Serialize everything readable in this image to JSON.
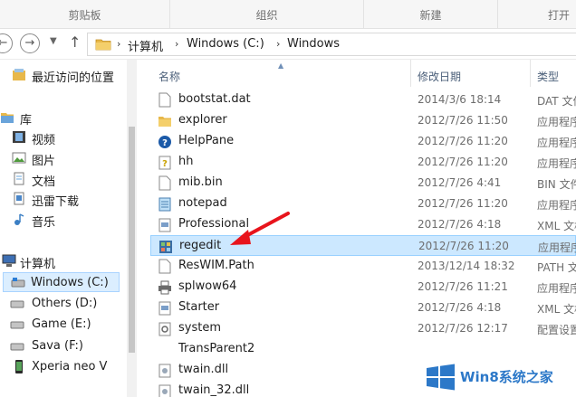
{
  "ribbon": {
    "groups": [
      "剪贴板",
      "组织",
      "新建",
      "打开"
    ]
  },
  "nav": {
    "back_icon": "back-arrow-icon",
    "forward_icon": "forward-arrow-icon",
    "breadcrumb": [
      "计算机",
      "Windows (C:)",
      "Windows"
    ]
  },
  "sidebar": {
    "items": [
      {
        "label": "最近访问的位置",
        "icon": "recent-places-icon"
      },
      {
        "label": "库",
        "icon": "library-icon"
      },
      {
        "label": "视频",
        "icon": "video-icon"
      },
      {
        "label": "图片",
        "icon": "pictures-icon"
      },
      {
        "label": "文档",
        "icon": "documents-icon"
      },
      {
        "label": "迅雷下载",
        "icon": "download-icon"
      },
      {
        "label": "音乐",
        "icon": "music-icon"
      },
      {
        "label": "计算机",
        "icon": "computer-icon"
      },
      {
        "label": "Windows (C:)",
        "icon": "drive-icon"
      },
      {
        "label": "Others (D:)",
        "icon": "drive-icon"
      },
      {
        "label": "Game (E:)",
        "icon": "drive-icon"
      },
      {
        "label": "Sava (F:)",
        "icon": "drive-icon"
      },
      {
        "label": "Xperia neo V",
        "icon": "phone-icon"
      }
    ]
  },
  "list": {
    "columns": {
      "name": "名称",
      "date": "修改日期",
      "type": "类型"
    },
    "rows": [
      {
        "name": "bootstat.dat",
        "date": "2014/3/6 18:14",
        "type": "DAT 文件",
        "icon": "file-icon"
      },
      {
        "name": "explorer",
        "date": "2012/7/26 11:50",
        "type": "应用程序",
        "icon": "folder-app-icon"
      },
      {
        "name": "HelpPane",
        "date": "2012/7/26 11:20",
        "type": "应用程序",
        "icon": "help-icon"
      },
      {
        "name": "hh",
        "date": "2012/7/26 11:20",
        "type": "应用程序",
        "icon": "help-doc-icon"
      },
      {
        "name": "mib.bin",
        "date": "2012/7/26 4:41",
        "type": "BIN 文件",
        "icon": "file-icon"
      },
      {
        "name": "notepad",
        "date": "2012/7/26 11:20",
        "type": "应用程序",
        "icon": "notepad-icon"
      },
      {
        "name": "Professional",
        "date": "2012/7/26 4:18",
        "type": "XML 文档",
        "icon": "xml-icon"
      },
      {
        "name": "regedit",
        "date": "2012/7/26 11:20",
        "type": "应用程序",
        "icon": "regedit-icon"
      },
      {
        "name": "ResWIM.Path",
        "date": "2013/12/14 18:32",
        "type": "PATH 文件",
        "icon": "file-icon"
      },
      {
        "name": "splwow64",
        "date": "2012/7/26 11:21",
        "type": "应用程序",
        "icon": "printer-icon"
      },
      {
        "name": "Starter",
        "date": "2012/7/26 4:18",
        "type": "XML 文档",
        "icon": "xml-icon"
      },
      {
        "name": "system",
        "date": "2012/7/26 12:17",
        "type": "配置设置",
        "icon": "settings-file-icon"
      },
      {
        "name": "TransParent2",
        "date": "",
        "type": "",
        "icon": ""
      },
      {
        "name": "twain.dll",
        "date": "",
        "type": "",
        "icon": "dll-icon"
      },
      {
        "name": "twain_32.dll",
        "date": "",
        "type": "",
        "icon": "dll-icon"
      }
    ]
  },
  "watermark": {
    "text": "Win8系统之家"
  },
  "colors": {
    "selection": "#cce8ff",
    "selection_border": "#99d1ff",
    "annotation": "#e8141c",
    "brand": "#2c78c8"
  }
}
